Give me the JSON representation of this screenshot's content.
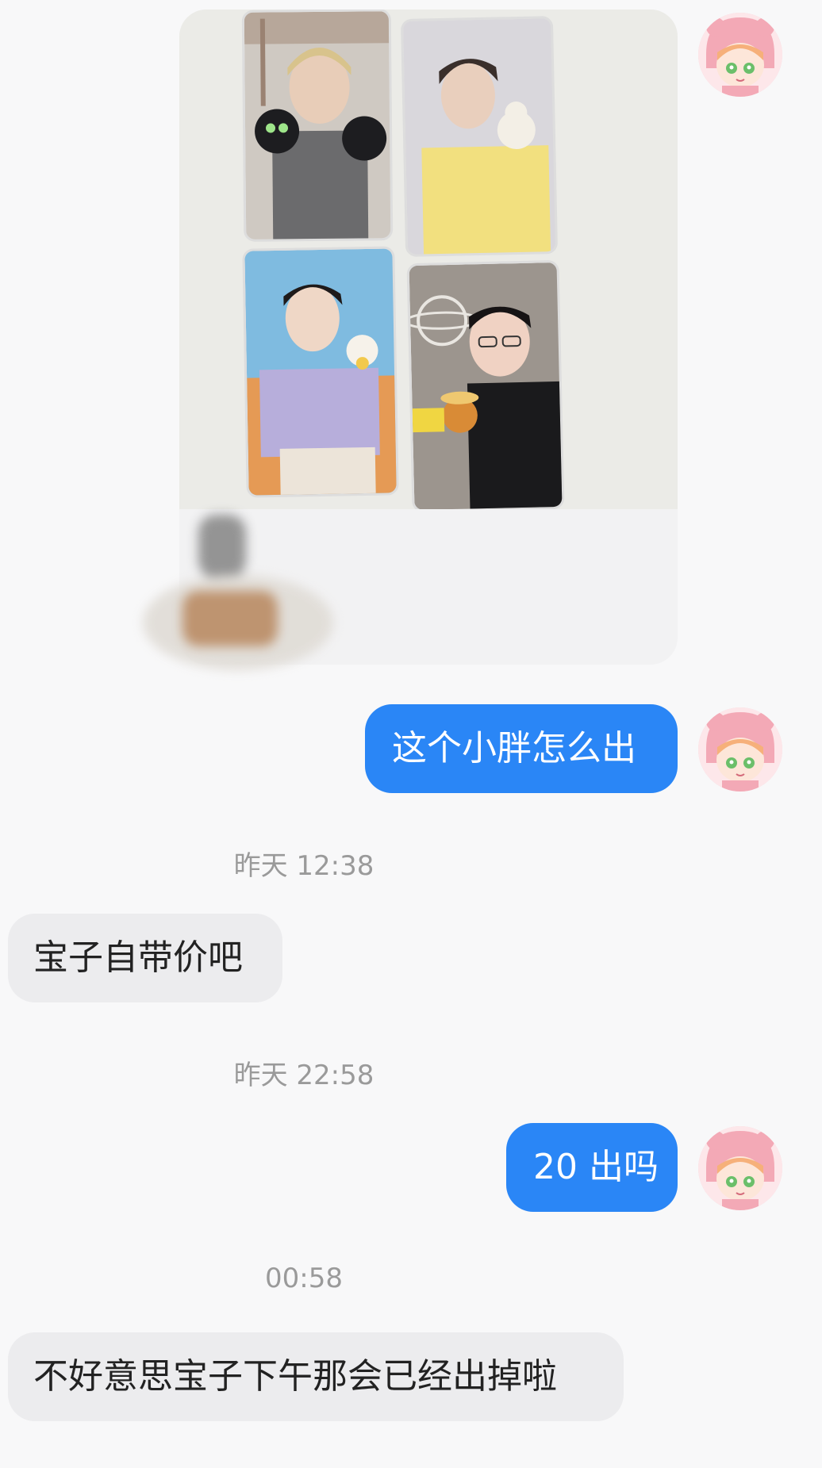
{
  "messages": {
    "out_1": "这个小胖怎么出",
    "ts_1": "昨天 12:38",
    "in_1": "宝子自带价吧",
    "ts_2": "昨天 22:58",
    "out_2": "20 出吗",
    "ts_3": "00:58",
    "in_2": "不好意思宝子下午那会已经出掉啦"
  },
  "colors": {
    "outgoing_bubble": "#2a86f6",
    "incoming_bubble": "#ececee",
    "background": "#f8f8f9",
    "timestamp_text": "#9a9a9a"
  },
  "icons": {
    "avatar": "anime-girl-pink-hood-avatar"
  }
}
